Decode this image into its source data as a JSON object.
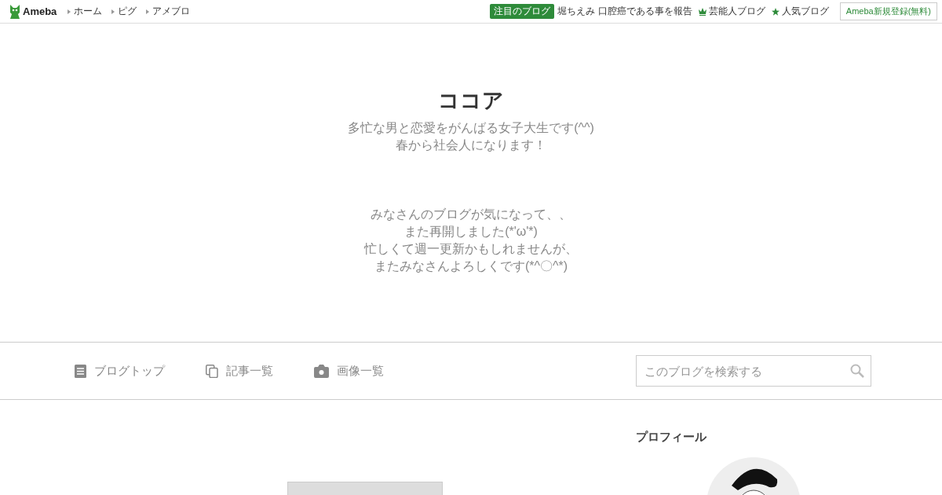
{
  "header": {
    "logo": "Ameba",
    "links": [
      "ホーム",
      "ピグ",
      "アメブロ"
    ],
    "featured_badge": "注目のブログ",
    "featured_text": "堀ちえみ 口腔癌である事を報告",
    "ranking_links": [
      {
        "kind": "crown",
        "label": "芸能人ブログ"
      },
      {
        "kind": "star",
        "label": "人気ブログ"
      }
    ],
    "signup_button": "Ameba新規登録(無料)"
  },
  "blog": {
    "title": "ココア",
    "description": [
      "多忙な男と恋愛をがんばる女子大生です(^^)",
      "春から社会人になります！"
    ],
    "message": [
      "みなさんのブログが気になって、、",
      "また再開しました(*'ω'*)",
      "忙しくて週一更新かもしれませんが、",
      "またみなさんよろしくです(*^〇^*)"
    ]
  },
  "nav": {
    "items": [
      {
        "kind": "doc",
        "label": "ブログトップ"
      },
      {
        "kind": "copy",
        "label": "記事一覧"
      },
      {
        "kind": "camera",
        "label": "画像一覧"
      }
    ],
    "search": {
      "placeholder": "このブログを検索する"
    }
  },
  "sidebar": {
    "heading": "プロフィール"
  }
}
